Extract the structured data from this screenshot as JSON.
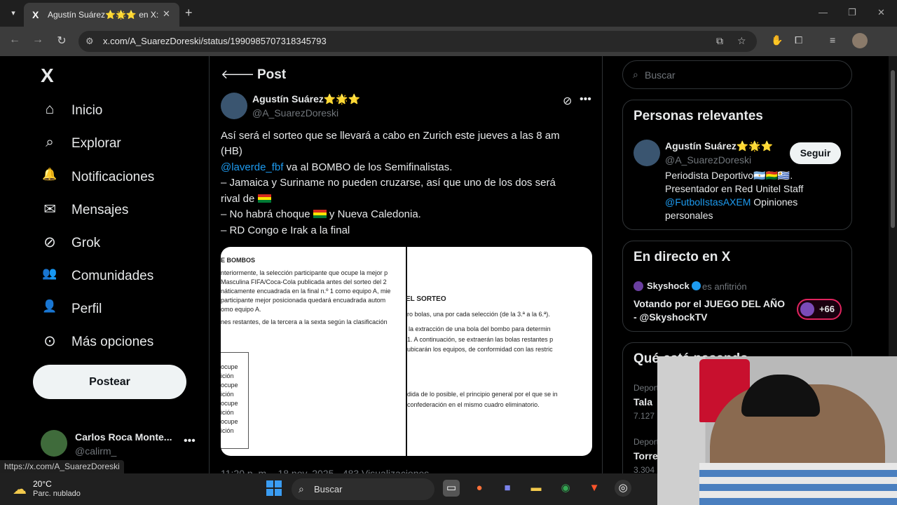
{
  "browser": {
    "tab_title": "Agustín Suárez⭐🌟⭐ en X: \"",
    "tab_favicon": "X",
    "url": "x.com/A_SuarezDoreski/status/1990985707318345793"
  },
  "nav": {
    "logo": "X",
    "items": [
      {
        "icon": "home-icon",
        "glyph": "⌂",
        "label": "Inicio"
      },
      {
        "icon": "search-icon",
        "glyph": "⌕",
        "label": "Explorar"
      },
      {
        "icon": "bell-icon",
        "glyph": "🔔",
        "label": "Notificaciones"
      },
      {
        "icon": "mail-icon",
        "glyph": "✉",
        "label": "Mensajes"
      },
      {
        "icon": "grok-icon",
        "glyph": "⊘",
        "label": "Grok"
      },
      {
        "icon": "communities-icon",
        "glyph": "👥",
        "label": "Comunidades"
      },
      {
        "icon": "profile-icon",
        "glyph": "👤",
        "label": "Perfil"
      },
      {
        "icon": "more-options-icon",
        "glyph": "⊙",
        "label": "Más opciones"
      }
    ],
    "post_button": "Postear",
    "account": {
      "name": "Carlos Roca Monte...",
      "handle": "@calirm_"
    }
  },
  "post": {
    "header_title": "Post",
    "author_name": "Agustín Suárez⭐🌟⭐",
    "author_handle": "@A_SuarezDoreski",
    "lines": {
      "l1": "Así será el sorteo que se llevará a cabo en Zurich este jueves a las 8 am",
      "l2": "(HB)",
      "l3_mention": "@laverde_fbf",
      "l3_rest": " va al BOMBO de los Semifinalistas.",
      "l4": "– Jamaica y Suriname no pueden cruzarse, así que uno de los dos será",
      "l5": "rival de ",
      "l6a": "– No habrá choque ",
      "l6b": " y Nueva Caledonia.",
      "l7": "– RD Congo e Irak a la final"
    },
    "media_text": {
      "h1": "E BOMBOS",
      "p1": "nteriormente, la selección participante que ocupe la mejor p",
      "p2": "Masculina FIFA/Coca-Cola publicada antes del sorteo del 2",
      "p3": "náticamente encuadrada en la final n.º 1 como equipo A, mie",
      "p4": "participante mejor posicionada quedará encuadrada autom",
      "p5": "omo equipo A.",
      "p6": "nes restantes, de la tercera a la sexta según la clasificación",
      "h2": "EL SORTEO",
      "q1": "ro bolas, una por cada selección (de la 3.ª a la 6.ª).",
      "q2": "la extracción de una bola del bombo para determin",
      "q3": "1. A continuación, se extraerán las bolas restantes p",
      "q4": "ubicarán los equipos, de conformidad con las restric",
      "q5": "dida de lo posible, el principio general por el que se in",
      "q6": "confederación en el mismo cuadro eliminatorio.",
      "b1": "ocupe",
      "b2": "ición",
      "b3": "ocupe",
      "b4": "ición",
      "b5": "ocupe",
      "b6": "ición",
      "b7": "ocupe",
      "b8": "ición"
    },
    "meta": "11:20 p. m. · 18 nov. 2025 · 483 Visualizaciones"
  },
  "right": {
    "search_placeholder": "Buscar",
    "relevant": {
      "title": "Personas relevantes",
      "name": "Agustín Suárez⭐🌟⭐",
      "handle": "@A_SuarezDoreski",
      "follow": "Seguir",
      "bio1": "Periodista Deportivo🇦🇷🇧🇴🇺🇾.",
      "bio2": "Presentador en Red Unitel Staff",
      "bio3_mention": "@FutbolIstasAXEM",
      "bio3_rest": " Opiniones",
      "bio4": "personales"
    },
    "live": {
      "title": "En directo en X",
      "host": "Skyshock",
      "role": "es anfitrión",
      "line1": "Votando por el JUEGO DEL AÑO",
      "line2": "- @SkyshockTV",
      "count": "+66"
    },
    "trends": {
      "title": "Qué está pasando",
      "items": [
        {
          "cat": "Deportes · Tendencia",
          "name": "Tala",
          "count": "7.127 posts"
        },
        {
          "cat": "Deportes · Tendencia",
          "name": "Torre",
          "count": "3.304 posts"
        }
      ]
    }
  },
  "status_url": "https://x.com/A_SuarezDoreski",
  "taskbar": {
    "temp": "20°C",
    "condition": "Parc. nublado",
    "search_label": "Buscar"
  }
}
